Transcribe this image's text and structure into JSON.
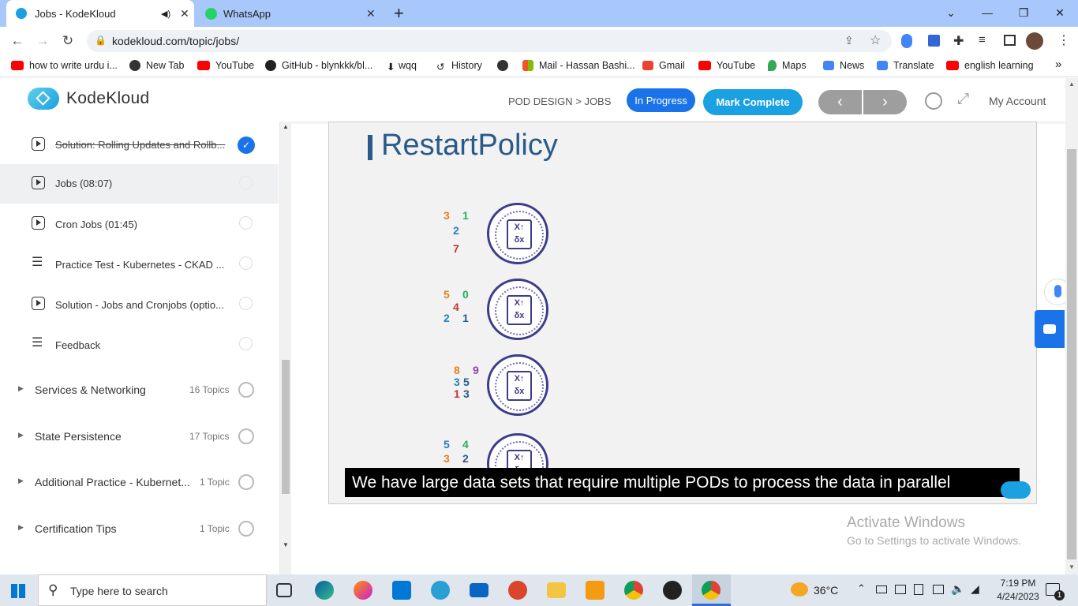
{
  "browser": {
    "tabs": [
      {
        "title": "Jobs - KodeKloud",
        "active": true
      },
      {
        "title": "WhatsApp",
        "active": false
      }
    ],
    "new_tab": "+",
    "url": "kodekloud.com/topic/jobs/",
    "bookmarks": [
      "how to write urdu i...",
      "New Tab",
      "YouTube",
      "GitHub - blynkkk/bl...",
      "wqq",
      "History",
      "Mail - Hassan Bashi...",
      "Gmail",
      "YouTube",
      "Maps",
      "News",
      "Translate",
      "english learning"
    ],
    "more_bookmarks": "»"
  },
  "header": {
    "brand": "KodeKloud",
    "breadcrumb": "POD DESIGN > JOBS",
    "status_badge": "In Progress",
    "mark_complete": "Mark Complete",
    "prev": "‹",
    "next": "›",
    "account": "My Account"
  },
  "sidebar": {
    "lessons": [
      {
        "label": "Solution: Rolling Updates and Rollb...",
        "type": "video",
        "completed": true
      },
      {
        "label": "Jobs (08:07)",
        "type": "video",
        "completed": false,
        "current": true
      },
      {
        "label": "Cron Jobs (01:45)",
        "type": "video",
        "completed": false
      },
      {
        "label": "Practice Test - Kubernetes - CKAD ...",
        "type": "text",
        "completed": false
      },
      {
        "label": "Solution - Jobs and Cronjobs (optio...",
        "type": "video",
        "completed": false
      },
      {
        "label": "Feedback",
        "type": "text",
        "completed": false
      }
    ],
    "sections": [
      {
        "label": "Services & Networking",
        "count": "16 Topics"
      },
      {
        "label": "State Persistence",
        "count": "17 Topics"
      },
      {
        "label": "Additional Practice - Kubernet...",
        "count": "1 Topic"
      },
      {
        "label": "Certification Tips",
        "count": "1 Topic"
      }
    ]
  },
  "video": {
    "slide_title": "RestartPolicy",
    "caption": "We have large data sets that require multiple PODs to process the data in parallel",
    "number_groups": [
      [
        "3",
        "1",
        "2",
        "7"
      ],
      [
        "5",
        "0",
        "4",
        "2",
        "1"
      ],
      [
        "8",
        "9",
        "3",
        "5",
        "1",
        "3"
      ],
      [
        "5",
        "4",
        "3",
        "2"
      ]
    ]
  },
  "watermark": {
    "line1": "Activate Windows",
    "line2": "Go to Settings to activate Windows."
  },
  "taskbar": {
    "search_placeholder": "Type here to search",
    "temperature": "36°C",
    "time": "7:19 PM",
    "date": "4/24/2023",
    "notification_count": "1"
  },
  "colors": {
    "accent_blue": "#1a73e8",
    "kodekloud_blue": "#1ba0e2",
    "tab_bar": "#a8c7fa",
    "check_blue": "#1a73e8"
  }
}
